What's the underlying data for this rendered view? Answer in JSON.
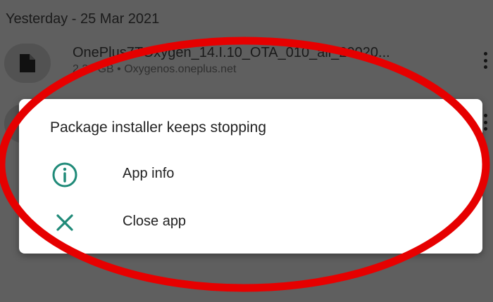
{
  "download_list": {
    "section_header": "Yesterday - 25 Mar 2021",
    "files": [
      {
        "name": "OnePlus7TOxygen_14.I.10_OTA_010_all_20020...",
        "meta": "2.39 GB • Oxygenos.oneplus.net",
        "icon": "file-icon"
      },
      {
        "name": "",
        "meta": "",
        "icon": "file-icon"
      }
    ]
  },
  "dialog": {
    "title": "Package installer keeps stopping",
    "actions": [
      {
        "label": "App info",
        "icon": "info-icon"
      },
      {
        "label": "Close app",
        "icon": "close-icon"
      }
    ]
  },
  "colors": {
    "accent": "#1f8a78",
    "annotation": "#e60000",
    "scrim_background": "#5f5f5f",
    "dialog_background": "#ffffff"
  }
}
